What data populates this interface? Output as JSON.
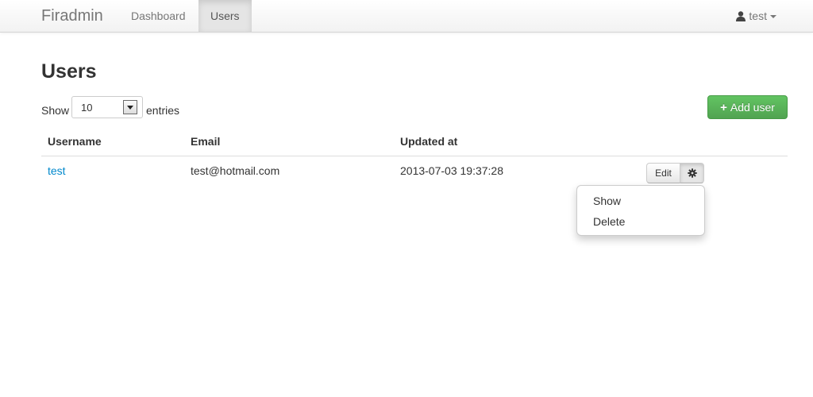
{
  "navbar": {
    "brand": "Firadmin",
    "items": [
      {
        "label": "Dashboard",
        "active": false
      },
      {
        "label": "Users",
        "active": true
      }
    ],
    "user": {
      "name": "test",
      "icon": "user-icon"
    }
  },
  "page": {
    "title": "Users"
  },
  "table_controls": {
    "show_label": "Show",
    "entries_value": "10",
    "entries_label": "entries",
    "add_button_label": "Add user",
    "add_button_icon": "plus-icon"
  },
  "table": {
    "columns": [
      "Username",
      "Email",
      "Updated at"
    ],
    "rows": [
      {
        "username": "test",
        "email": "test@hotmail.com",
        "updated_at": "2013-07-03 19:37:28"
      }
    ]
  },
  "row_actions": {
    "edit_label": "Edit",
    "menu_icon": "gear-icon",
    "menu_items": [
      "Show",
      "Delete"
    ]
  },
  "colors": {
    "link": "#0088cc",
    "success": "#5bb75b",
    "navbar_text": "#777777"
  }
}
